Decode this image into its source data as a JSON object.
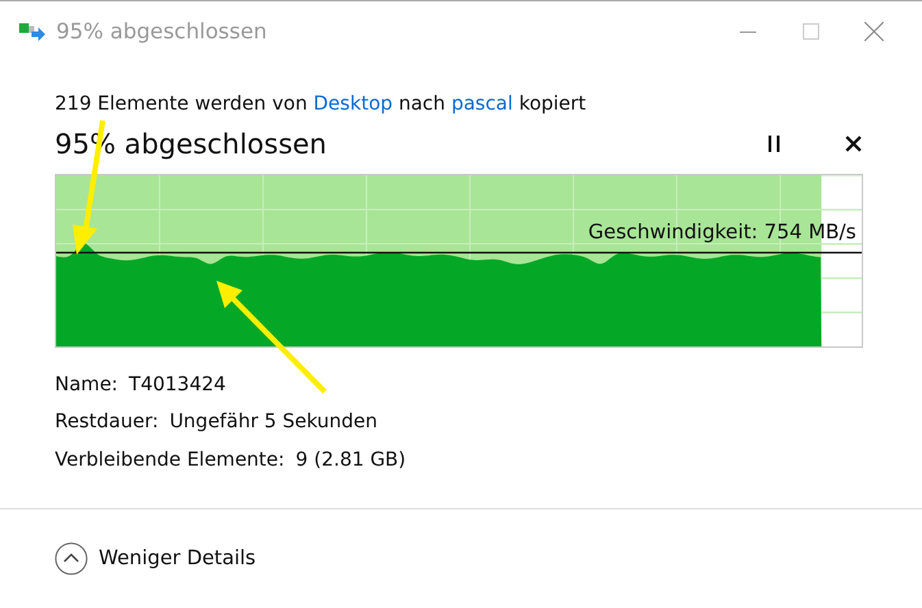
{
  "window": {
    "title": "95% abgeschlossen"
  },
  "summary": [
    {
      "kind": "text",
      "text": "219 Elemente werden von "
    },
    {
      "kind": "link",
      "text": "Desktop"
    },
    {
      "kind": "text",
      "text": " nach "
    },
    {
      "kind": "link",
      "text": "pascal"
    },
    {
      "kind": "text",
      "text": " kopiert"
    }
  ],
  "heading": "95% abgeschlossen",
  "graph": {
    "level": 0.95,
    "speed": "Geschwindigkeit: 754 MB/s"
  },
  "details": [
    {
      "label": "Name:",
      "value": "T4013424"
    },
    {
      "label": "Restdauer:",
      "value": "Ungefähr 5 Sekunden"
    },
    {
      "label": "Verbleibende Elemente:",
      "value": "9 (2.81 GB)"
    }
  ],
  "footer": {
    "label": "Weniger Details"
  }
}
